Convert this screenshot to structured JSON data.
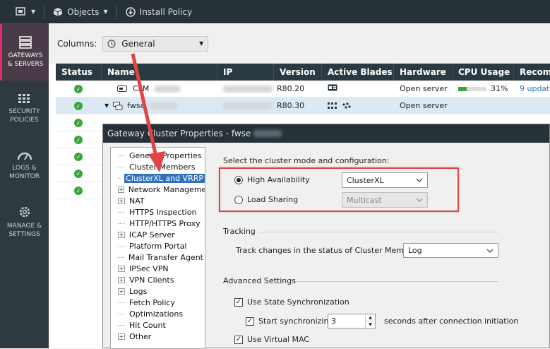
{
  "toolbar": {
    "objects_label": "Objects",
    "install_policy_label": "Install Policy"
  },
  "sidebar": {
    "items": [
      {
        "label1": "GATEWAYS",
        "label2": "& SERVERS"
      },
      {
        "label1": "SECURITY",
        "label2": "POLICIES"
      },
      {
        "label1": "LOGS &",
        "label2": "MONITOR"
      },
      {
        "label1": "MANAGE &",
        "label2": "SETTINGS"
      }
    ]
  },
  "columns": {
    "label": "Columns:",
    "value": "General"
  },
  "table": {
    "headers": [
      "Status",
      "Name",
      "IP",
      "Version",
      "Active Blades",
      "Hardware",
      "CPU Usage",
      "Recom"
    ],
    "rows": [
      {
        "name": "CLM",
        "version": "R80.20",
        "hardware": "Open server",
        "cpu": "31%",
        "cpu_fill": 0.31,
        "recom": "9 updat"
      },
      {
        "name": "fwse",
        "version": "R80.30",
        "hardware": "Open server",
        "cpu": "",
        "recom": ""
      },
      {
        "name": "",
        "version": "",
        "hardware": "",
        "cpu": "",
        "recom": ""
      },
      {
        "name": "",
        "version": "",
        "hardware": "",
        "cpu": "",
        "recom": ""
      },
      {
        "name": "",
        "version": "",
        "hardware": "",
        "cpu": "",
        "recom": ""
      },
      {
        "name": "",
        "version": "",
        "hardware": "",
        "cpu": "",
        "recom": ""
      },
      {
        "name": "",
        "version": "",
        "hardware": "",
        "cpu": "",
        "recom": ""
      }
    ]
  },
  "dialog": {
    "title": "Gateway Cluster Properties - fwse",
    "tree": [
      {
        "label": "General Properties",
        "expandable": false
      },
      {
        "label": "Cluster Members",
        "expandable": false
      },
      {
        "label": "ClusterXL and VRRP",
        "expandable": false,
        "selected": true
      },
      {
        "label": "Network Management",
        "expandable": true
      },
      {
        "label": "NAT",
        "expandable": true
      },
      {
        "label": "HTTPS Inspection",
        "expandable": false
      },
      {
        "label": "HTTP/HTTPS Proxy",
        "expandable": false
      },
      {
        "label": "ICAP Server",
        "expandable": true
      },
      {
        "label": "Platform Portal",
        "expandable": false
      },
      {
        "label": "Mail Transfer Agent",
        "expandable": false
      },
      {
        "label": "IPSec VPN",
        "expandable": true
      },
      {
        "label": "VPN Clients",
        "expandable": true
      },
      {
        "label": "Logs",
        "expandable": true
      },
      {
        "label": "Fetch Policy",
        "expandable": false
      },
      {
        "label": "Optimizations",
        "expandable": false
      },
      {
        "label": "Hit Count",
        "expandable": false
      },
      {
        "label": "Other",
        "expandable": true
      }
    ],
    "panel": {
      "mode_heading": "Select the cluster mode and configuration:",
      "ha_label": "High Availability",
      "ha_value": "ClusterXL",
      "ls_label": "Load Sharing",
      "ls_value": "Multicast",
      "tracking_heading": "Tracking",
      "track_label": "Track changes in the status of Cluster Members:",
      "track_value": "Log",
      "advanced_heading": "Advanced Settings",
      "state_sync_label": "Use State Synchronization",
      "start_sync_label": "Start synchronizing",
      "start_sync_value": "3",
      "start_sync_suffix": "seconds after connection initiation",
      "virtual_mac_label": "Use Virtual MAC"
    }
  },
  "colors": {
    "accent": "#e0306a",
    "selection": "#3072c0",
    "highlight_box": "#e04545",
    "status_ok": "#3aa63a"
  }
}
